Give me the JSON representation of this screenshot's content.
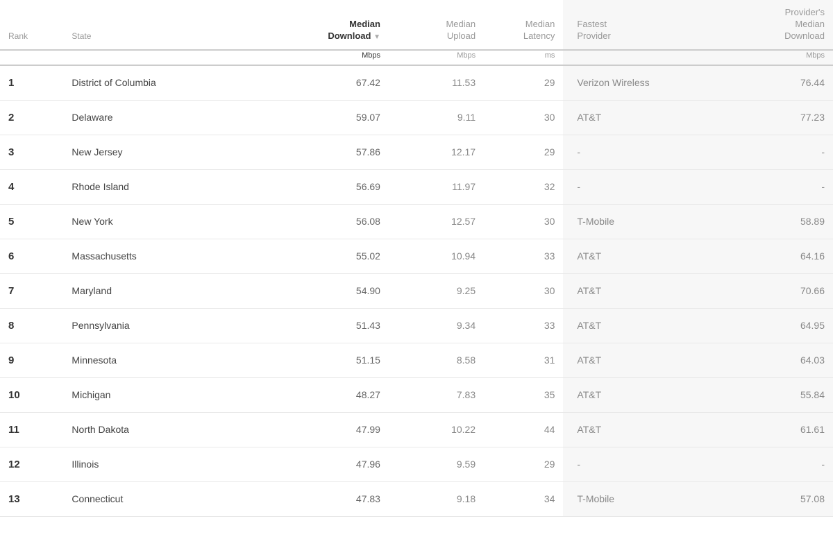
{
  "header": {
    "col_rank": "Rank",
    "col_state": "State",
    "col_download_line1": "Median",
    "col_download_line2": "Download",
    "col_download_unit": "Mbps",
    "col_upload_line1": "Median",
    "col_upload_line2": "Upload",
    "col_upload_unit": "Mbps",
    "col_latency_line1": "Median",
    "col_latency_line2": "Latency",
    "col_latency_unit": "ms",
    "col_fastest_line1": "Fastest",
    "col_fastest_line2": "Provider",
    "col_provider_line1": "Provider's",
    "col_provider_line2": "Median",
    "col_provider_line3": "Download",
    "col_provider_unit": "Mbps"
  },
  "rows": [
    {
      "rank": "1",
      "state": "District of Columbia",
      "download": "67.42",
      "upload": "11.53",
      "latency": "29",
      "fastest": "Verizon Wireless",
      "provider_download": "76.44"
    },
    {
      "rank": "2",
      "state": "Delaware",
      "download": "59.07",
      "upload": "9.11",
      "latency": "30",
      "fastest": "AT&T",
      "provider_download": "77.23"
    },
    {
      "rank": "3",
      "state": "New Jersey",
      "download": "57.86",
      "upload": "12.17",
      "latency": "29",
      "fastest": "-",
      "provider_download": "-"
    },
    {
      "rank": "4",
      "state": "Rhode Island",
      "download": "56.69",
      "upload": "11.97",
      "latency": "32",
      "fastest": "-",
      "provider_download": "-"
    },
    {
      "rank": "5",
      "state": "New York",
      "download": "56.08",
      "upload": "12.57",
      "latency": "30",
      "fastest": "T-Mobile",
      "provider_download": "58.89"
    },
    {
      "rank": "6",
      "state": "Massachusetts",
      "download": "55.02",
      "upload": "10.94",
      "latency": "33",
      "fastest": "AT&T",
      "provider_download": "64.16"
    },
    {
      "rank": "7",
      "state": "Maryland",
      "download": "54.90",
      "upload": "9.25",
      "latency": "30",
      "fastest": "AT&T",
      "provider_download": "70.66"
    },
    {
      "rank": "8",
      "state": "Pennsylvania",
      "download": "51.43",
      "upload": "9.34",
      "latency": "33",
      "fastest": "AT&T",
      "provider_download": "64.95"
    },
    {
      "rank": "9",
      "state": "Minnesota",
      "download": "51.15",
      "upload": "8.58",
      "latency": "31",
      "fastest": "AT&T",
      "provider_download": "64.03"
    },
    {
      "rank": "10",
      "state": "Michigan",
      "download": "48.27",
      "upload": "7.83",
      "latency": "35",
      "fastest": "AT&T",
      "provider_download": "55.84"
    },
    {
      "rank": "11",
      "state": "North Dakota",
      "download": "47.99",
      "upload": "10.22",
      "latency": "44",
      "fastest": "AT&T",
      "provider_download": "61.61"
    },
    {
      "rank": "12",
      "state": "Illinois",
      "download": "47.96",
      "upload": "9.59",
      "latency": "29",
      "fastest": "-",
      "provider_download": "-"
    },
    {
      "rank": "13",
      "state": "Connecticut",
      "download": "47.83",
      "upload": "9.18",
      "latency": "34",
      "fastest": "T-Mobile",
      "provider_download": "57.08"
    }
  ]
}
